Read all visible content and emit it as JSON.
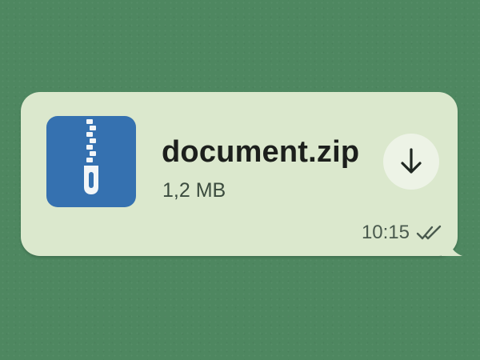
{
  "message": {
    "file_name": "document.zip",
    "file_size": "1,2 MB",
    "timestamp": "10:15",
    "file_icon": "zip-archive-icon",
    "download_icon": "download-arrow-icon",
    "status_icon": "double-check-icon"
  },
  "colors": {
    "chat_background": "#4e8760",
    "bubble": "#dbe8cd",
    "file_icon_background": "#3571b0",
    "download_button": "#edf3e6",
    "text_primary": "#1c1f1c",
    "text_secondary": "#4a5a4e"
  }
}
